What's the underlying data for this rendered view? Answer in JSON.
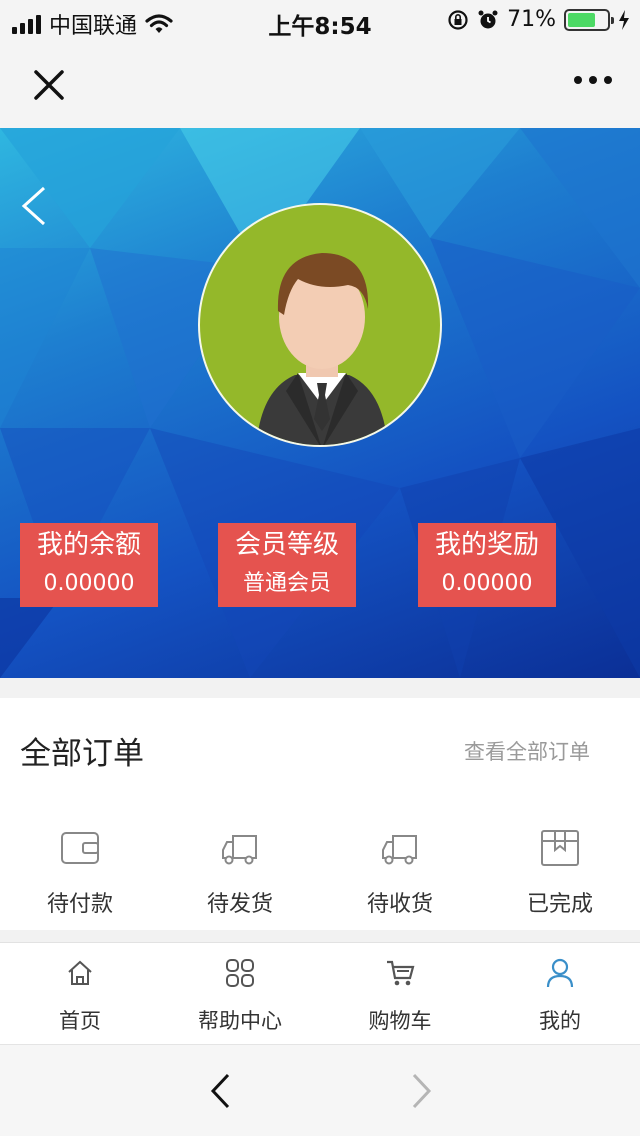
{
  "status_bar": {
    "carrier": "中国联通",
    "time": "上午8:54",
    "battery_percent": "71%",
    "battery_level": 0.71
  },
  "hero": {
    "stats": [
      {
        "label": "我的余额",
        "value": "0.00000"
      },
      {
        "label": "会员等级",
        "value": "普通会员"
      },
      {
        "label": "我的奖励",
        "value": "0.00000"
      }
    ]
  },
  "orders": {
    "title": "全部订单",
    "view_all": "查看全部订单",
    "items": [
      {
        "label": "待付款",
        "icon": "wallet-icon"
      },
      {
        "label": "待发货",
        "icon": "truck-icon"
      },
      {
        "label": "待收货",
        "icon": "truck-icon"
      },
      {
        "label": "已完成",
        "icon": "box-icon"
      }
    ]
  },
  "tabbar": {
    "items": [
      {
        "label": "首页",
        "icon": "home-icon"
      },
      {
        "label": "帮助中心",
        "icon": "grid-icon"
      },
      {
        "label": "购物车",
        "icon": "cart-icon"
      },
      {
        "label": "我的",
        "icon": "user-icon",
        "active": true
      }
    ]
  },
  "colors": {
    "stat_bg": "#e5534f",
    "avatar_bg": "#94b82a",
    "active_tab": "#3a8fc9"
  }
}
